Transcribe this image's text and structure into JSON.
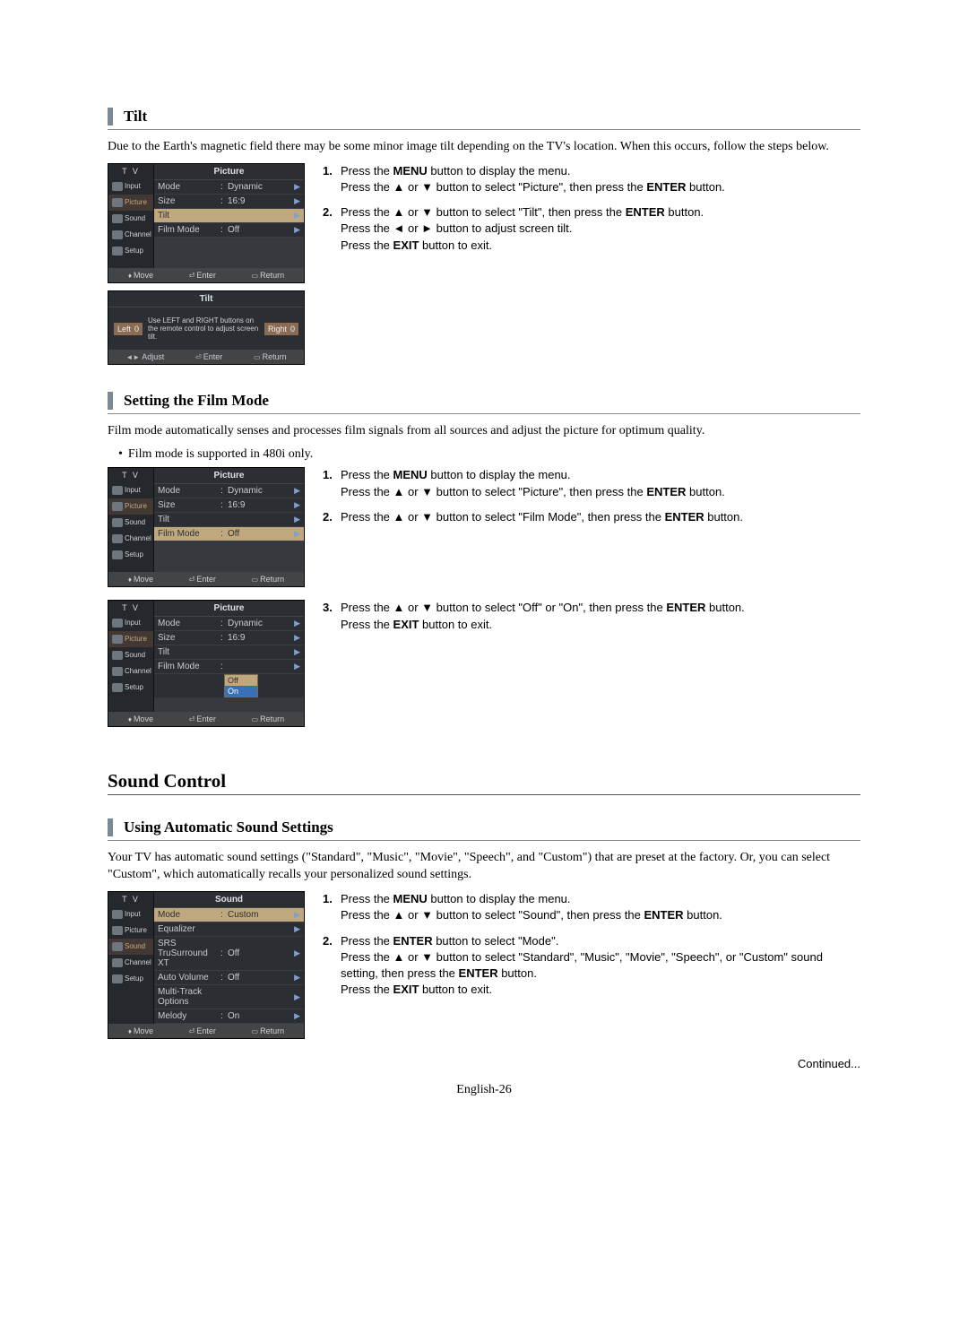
{
  "sections": {
    "tilt": {
      "heading": "Tilt",
      "intro": "Due to the Earth's magnetic field there may be some minor image tilt depending on the TV's location. When this occurs, follow the steps below.",
      "steps": [
        {
          "n": "1.",
          "lines": [
            "Press the <b>MENU</b> button to display the menu.",
            "Press the ▲ or ▼ button to select \"Picture\", then press the <b>ENTER</b> button."
          ]
        },
        {
          "n": "2.",
          "lines": [
            "Press the ▲ or ▼ button to select \"Tilt\", then press the <b>ENTER</b> button.",
            "Press the ◄ or ► button to adjust screen tilt.",
            "Press the <b>EXIT</b> button to exit."
          ]
        }
      ]
    },
    "filmMode": {
      "heading": "Setting the Film Mode",
      "intro": "Film mode automatically senses and processes film signals from all sources and adjust the picture for optimum quality.",
      "bullet": "Film mode is supported in 480i only.",
      "stepsTop": [
        {
          "n": "1.",
          "lines": [
            "Press the <b>MENU</b> button to display the menu.",
            "Press the ▲ or ▼ button to select \"Picture\", then press the <b>ENTER</b> button."
          ]
        },
        {
          "n": "2.",
          "lines": [
            "Press the ▲ or ▼ button to select \"Film Mode\", then press the <b>ENTER</b> button."
          ]
        }
      ],
      "stepsBottom": [
        {
          "n": "3.",
          "lines": [
            "Press the ▲ or ▼ button to select \"Off\" or \"On\", then press the <b>ENTER</b> button.",
            "Press the <b>EXIT</b> button to exit."
          ]
        }
      ]
    },
    "soundControl": {
      "heading": "Sound Control"
    },
    "autoSound": {
      "heading": "Using Automatic Sound Settings",
      "intro": "Your TV has automatic sound settings (\"Standard\", \"Music\", \"Movie\", \"Speech\", and \"Custom\") that are preset at the factory. Or, you can select \"Custom\", which automatically recalls your personalized sound settings.",
      "steps": [
        {
          "n": "1.",
          "lines": [
            "Press the <b>MENU</b> button to display the menu.",
            "Press the ▲ or ▼ button to select \"Sound\", then press the <b>ENTER</b> button."
          ]
        },
        {
          "n": "2.",
          "lines": [
            "Press the <b>ENTER</b> button to select \"Mode\".",
            "Press the ▲ or ▼ button to select \"Standard\", \"Music\", \"Movie\", \"Speech\", or \"Custom\" sound setting, then press the <b>ENTER</b> button.",
            "Press the <b>EXIT</b> button to exit."
          ]
        }
      ]
    }
  },
  "osd": {
    "tvLabel": "T V",
    "sidebar": [
      "Input",
      "Picture",
      "Sound",
      "Channel",
      "Setup"
    ],
    "footerMove": "Move",
    "footerAdjust": "Adjust",
    "footerEnter": "Enter",
    "footerReturn": "Return",
    "pictureTitle": "Picture",
    "soundTitle": "Sound",
    "tiltTitle": "Tilt",
    "tiltHelp": "Use LEFT and RIGHT buttons on the remote control to adjust screen tilt.",
    "tiltLeft": "Left",
    "tiltRight": "Right",
    "tiltLeftVal": "0",
    "tiltRightVal": "0",
    "picture1": {
      "rows": [
        {
          "label": "Mode",
          "val": "Dynamic"
        },
        {
          "label": "Size",
          "val": "16:9"
        },
        {
          "label": "Tilt",
          "val": "",
          "hl": true
        },
        {
          "label": "Film Mode",
          "val": "Off"
        }
      ]
    },
    "picture2": {
      "rows": [
        {
          "label": "Mode",
          "val": "Dynamic"
        },
        {
          "label": "Size",
          "val": "16:9"
        },
        {
          "label": "Tilt",
          "val": ""
        },
        {
          "label": "Film Mode",
          "val": "Off",
          "hl": true
        }
      ]
    },
    "picture3": {
      "rows": [
        {
          "label": "Mode",
          "val": "Dynamic"
        },
        {
          "label": "Size",
          "val": "16:9"
        },
        {
          "label": "Tilt",
          "val": ""
        },
        {
          "label": "Film Mode",
          "val": "",
          "optbox": true
        }
      ],
      "options": [
        "Off",
        "On"
      ],
      "optSel": 1
    },
    "sound1": {
      "rows": [
        {
          "label": "Mode",
          "val": "Custom",
          "hl": true
        },
        {
          "label": "Equalizer",
          "val": ""
        },
        {
          "label": "SRS TruSurround XT",
          "val": "Off"
        },
        {
          "label": "Auto Volume",
          "val": "Off"
        },
        {
          "label": "Multi-Track Options",
          "val": ""
        },
        {
          "label": "Melody",
          "val": "On"
        }
      ]
    }
  },
  "continued": "Continued...",
  "pageNum": "English-26"
}
